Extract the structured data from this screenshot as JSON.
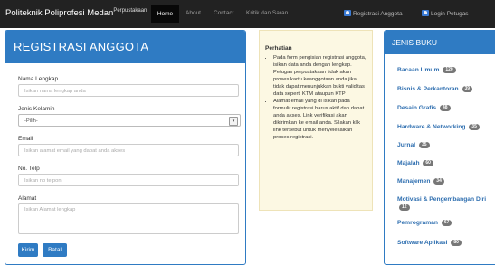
{
  "navbar": {
    "brand": "Politeknik Poliprofesi Medan",
    "brand_sup": "Perpustakaan",
    "links": [
      "Home",
      "About",
      "Contact",
      "Kritik dan Saran"
    ],
    "right_links": [
      "Registrasi Anggota",
      "Login Petugas"
    ]
  },
  "registration": {
    "title": "REGISTRASI ANGGOTA",
    "fields": {
      "name_label": "Nama Lengkap",
      "name_placeholder": "Isikan nama lengkap anda",
      "gender_label": "Jenis Kelamin",
      "gender_selected": "-Pilih-",
      "email_label": "Email",
      "email_placeholder": "Isikan alamat email yang dapat anda akses",
      "phone_label": "No. Telp",
      "phone_placeholder": "Isikan no telpon",
      "address_label": "Alamat",
      "address_placeholder": "Isikan Alamat lengkap"
    },
    "buttons": {
      "submit": "Kirim",
      "cancel": "Batal"
    }
  },
  "notice": {
    "title": "Perhatian",
    "items": [
      "Pada form pengisian registrasi anggota, isikan data anda dengan lengkap. Petugas perpustakaan tidak akan proses kartu keanggotaan anda jika tidak dapat menunjukkan bukti validitas data seperti KTM ataupun KTP",
      "Alamat email yang di isikan pada formulir registrasi harus aktif dan dapat anda akses. Link verifikasi akan dikirimkan ke email anda. Silakan klik link tersebut untuk menyelesaikan proses registrasi."
    ]
  },
  "categories": {
    "title": "JENIS BUKU",
    "items": [
      {
        "label": "Bacaan Umum",
        "count": "120"
      },
      {
        "label": "Bisnis & Perkantoran",
        "count": "39"
      },
      {
        "label": "Desain Grafis",
        "count": "48"
      },
      {
        "label": "Hardware & Networking",
        "count": "35"
      },
      {
        "label": "Jurnal",
        "count": "35"
      },
      {
        "label": "Majalah",
        "count": "60"
      },
      {
        "label": "Manajemen",
        "count": "34"
      },
      {
        "label": "Motivasi & Pengembangan Diri",
        "count": "12"
      },
      {
        "label": "Pemrograman",
        "count": "67"
      },
      {
        "label": "Software Aplikasi",
        "count": "80"
      }
    ]
  }
}
